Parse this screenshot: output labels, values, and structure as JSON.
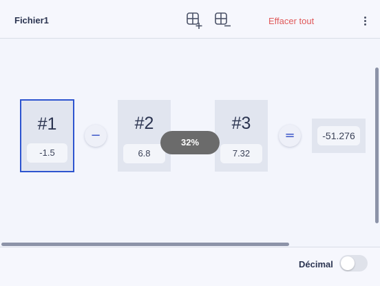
{
  "header": {
    "file_title": "Fichier1",
    "clear_all_label": "Effacer tout",
    "icons": [
      "add-column-icon",
      "remove-column-icon",
      "more-vert-icon"
    ]
  },
  "cards": [
    {
      "label": "#1",
      "value": "-1.5",
      "selected": true
    },
    {
      "label": "#2",
      "value": "6.8",
      "selected": false
    },
    {
      "label": "#3",
      "value": "7.32",
      "selected": false
    }
  ],
  "operators": {
    "op1": "−",
    "equals": "="
  },
  "result": {
    "value": "-51.276"
  },
  "zoom": {
    "label": "32%"
  },
  "footer": {
    "decimal_label": "Décimal",
    "decimal_enabled": false
  },
  "colors": {
    "accent": "#2d54cf",
    "danger": "#e0595a"
  }
}
